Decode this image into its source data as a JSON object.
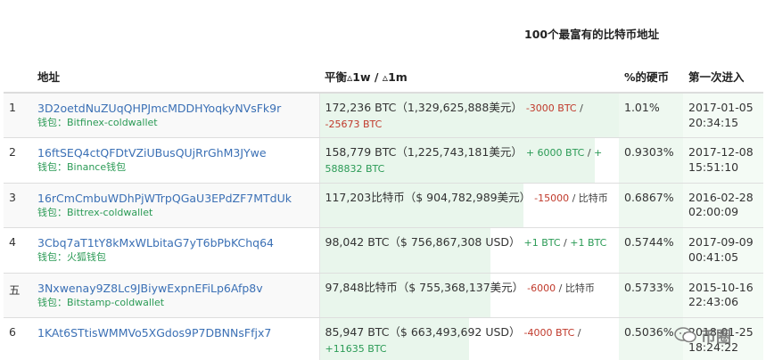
{
  "page_title": "100个最富有的比特币地址",
  "columns": {
    "address": "地址",
    "balance": "平衡▵1w / ▵1m",
    "percent": "%的硬币",
    "first_in": "第一次进入"
  },
  "rows": [
    {
      "index": "1",
      "address": "3D2oetdNuZUqQHPJmcMDDHYoqkyNVsFk9r",
      "wallet": "钱包：Bitfinex-coldwallet",
      "balance_main": "172,236 BTC（1,329,625,888美元）",
      "change_1w": "-3000 BTC",
      "change_1w_sign": "neg",
      "sep": " / ",
      "change_1m": "-25673 BTC",
      "change_1m_sign": "neg",
      "percent": "1.01%",
      "first_in_date": "2017-01-05",
      "first_in_time": "20:34:15",
      "bar_fraction": 1.0
    },
    {
      "index": "2",
      "address": "16ftSEQ4ctQFDtVZiUBusQUjRrGhM3JYwe",
      "wallet": "钱包：Binance钱包",
      "balance_main": "158,779 BTC（1,225,743,181美元）",
      "change_1w": "+ 6000 BTC",
      "change_1w_sign": "pos",
      "sep": " / ",
      "change_1m": "+ 588832 BTC",
      "change_1m_sign": "pos",
      "percent": "0.9303%",
      "first_in_date": "2017-12-08",
      "first_in_time": "15:51:10",
      "bar_fraction": 0.92
    },
    {
      "index": "3",
      "address": "16rCmCmbuWDhPjWTrpQGaU3EPdZF7MTdUk",
      "wallet": "钱包：Bittrex-coldwallet",
      "balance_main": "117,203比特币（$ 904,782,989美元）",
      "change_1w": "-15000",
      "change_1w_sign": "neg",
      "sep": " / ",
      "change_1m": "比特币",
      "change_1m_sign": "plain",
      "percent": "0.6867%",
      "first_in_date": "2016-02-28",
      "first_in_time": "02:00:09",
      "bar_fraction": 0.68
    },
    {
      "index": "4",
      "address": "3Cbq7aT1tY8kMxWLbitaG7yT6bPbKChq64",
      "wallet": "钱包：火狐钱包",
      "balance_main": "98,042 BTC（$ 756,867,308 USD）",
      "change_1w": "+1 BTC",
      "change_1w_sign": "pos",
      "sep": " / ",
      "change_1m": "+1 BTC",
      "change_1m_sign": "pos",
      "percent": "0.5744%",
      "first_in_date": "2017-09-09",
      "first_in_time": "00:41:05",
      "bar_fraction": 0.57
    },
    {
      "index": "五",
      "address": "3Nxwenay9Z8Lc9JBiywExpnEFiLp6Afp8v",
      "wallet": "钱包：Bitstamp-coldwallet",
      "balance_main": "97,848比特币（$ 755,368,137美元）",
      "change_1w": "-6000",
      "change_1w_sign": "neg",
      "sep": " / ",
      "change_1m": "比特币",
      "change_1m_sign": "plain",
      "percent": "0.5733%",
      "first_in_date": "2015-10-16",
      "first_in_time": "22:43:06",
      "bar_fraction": 0.57
    },
    {
      "index": "6",
      "address": "1KAt6STtisWMMVo5XGdos9P7DBNNsFfjx7",
      "wallet": "",
      "balance_main": "85,947 BTC（$ 663,493,692 USD）",
      "change_1w": "-4000 BTC",
      "change_1w_sign": "neg",
      "sep": " / ",
      "change_1m": "+11635 BTC",
      "change_1m_sign": "pos",
      "percent": "0.5036%",
      "first_in_date": "2018-01-25",
      "first_in_time": "18:24:22",
      "bar_fraction": 0.5
    }
  ],
  "watermark": {
    "text": "币圈",
    "icon": "wechat-icon"
  },
  "colors": {
    "link": "#3b70b5",
    "wallet": "#2a9a55",
    "negative": "#c0392b",
    "positive": "#2a9a55",
    "bar": "#e9f6ec"
  }
}
